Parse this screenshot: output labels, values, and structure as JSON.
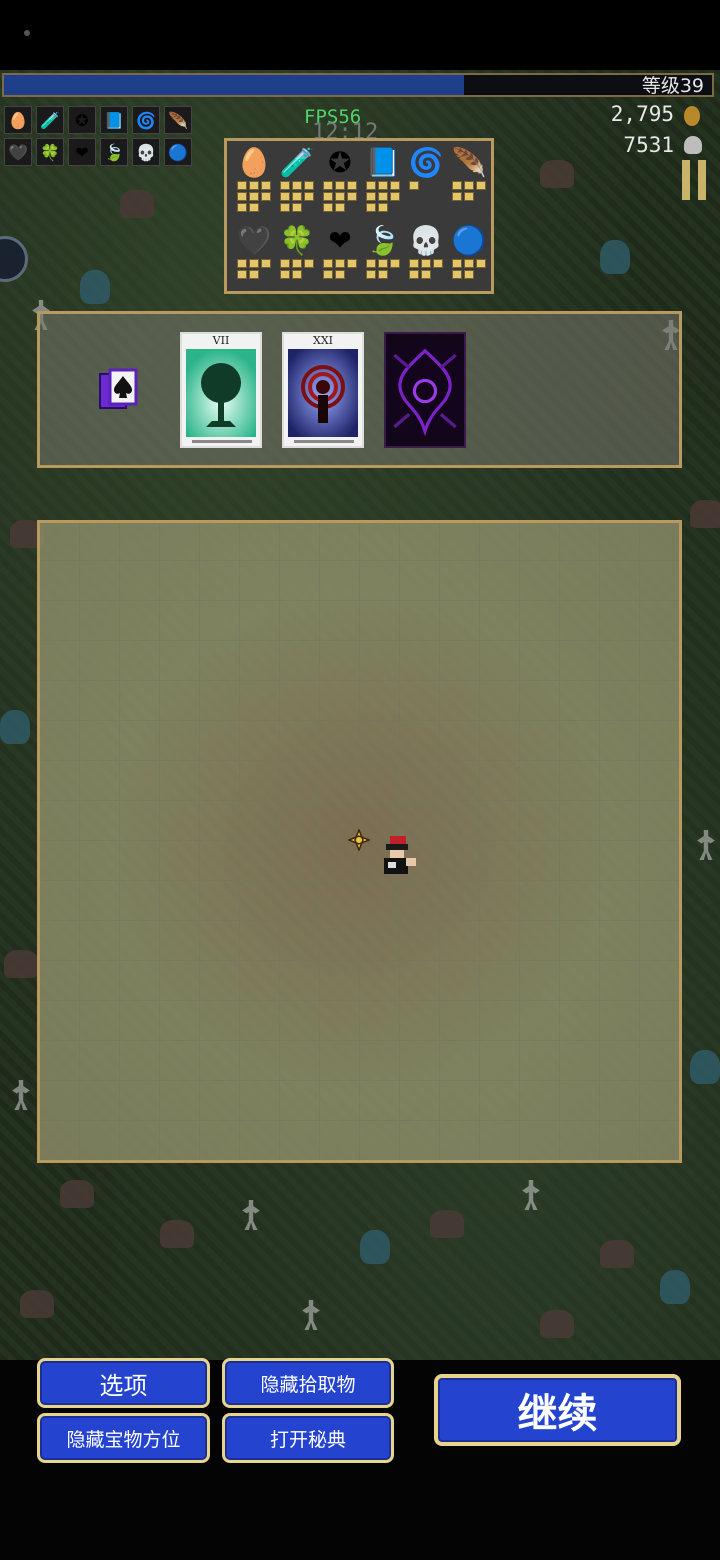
{
  "hud": {
    "level_label": "等级39",
    "xp_fraction": 0.65,
    "fps": "FPS56",
    "timer": "12:12",
    "gold": "2,795",
    "kills": "7531"
  },
  "hud_weapon_icons": [
    "bag-icon",
    "potion-icon",
    "pentagram-icon",
    "tome-icon",
    "spiral-icon",
    "quill-icon"
  ],
  "hud_passive_icons": [
    "heart-icon",
    "clover-icon",
    "red-heart-icon",
    "feather-icon",
    "skull-icon",
    "orb-icon"
  ],
  "inventory": {
    "weapons": [
      {
        "name": "bag-icon",
        "glyph": "🥚",
        "level": 8
      },
      {
        "name": "potion-icon",
        "glyph": "🧪",
        "level": 8
      },
      {
        "name": "pentagram-icon",
        "glyph": "✪",
        "level": 8
      },
      {
        "name": "tome-icon",
        "glyph": "📘",
        "level": 8
      },
      {
        "name": "spiral-icon",
        "glyph": "🌀",
        "level": 1
      },
      {
        "name": "quill-icon",
        "glyph": "🪶",
        "level": 5
      }
    ],
    "passives": [
      {
        "name": "heart-icon",
        "glyph": "🖤",
        "level": 5
      },
      {
        "name": "clover-icon",
        "glyph": "🍀",
        "level": 5
      },
      {
        "name": "red-heart-icon",
        "glyph": "❤",
        "level": 5
      },
      {
        "name": "feather-icon",
        "glyph": "🍃",
        "level": 5
      },
      {
        "name": "skull-icon",
        "glyph": "💀",
        "level": 5
      },
      {
        "name": "orb-icon",
        "glyph": "🔵",
        "level": 5
      }
    ]
  },
  "arcana": {
    "cards": [
      {
        "label": "VII",
        "art": "tree"
      },
      {
        "label": "XXI",
        "art": "vortex"
      },
      {
        "label": "",
        "art": "back"
      }
    ]
  },
  "buttons": {
    "options": "选项",
    "hide_pickups": "隐藏拾取物",
    "hide_treasure": "隐藏宝物方位",
    "open_codex": "打开秘典",
    "continue": "继续"
  },
  "colors": {
    "button_fill": "#2443cf",
    "button_border": "#e8d38a",
    "panel_border": "#b89a5e",
    "xp_fill": "#1f3e8c",
    "fps_green": "#4fd36a"
  }
}
